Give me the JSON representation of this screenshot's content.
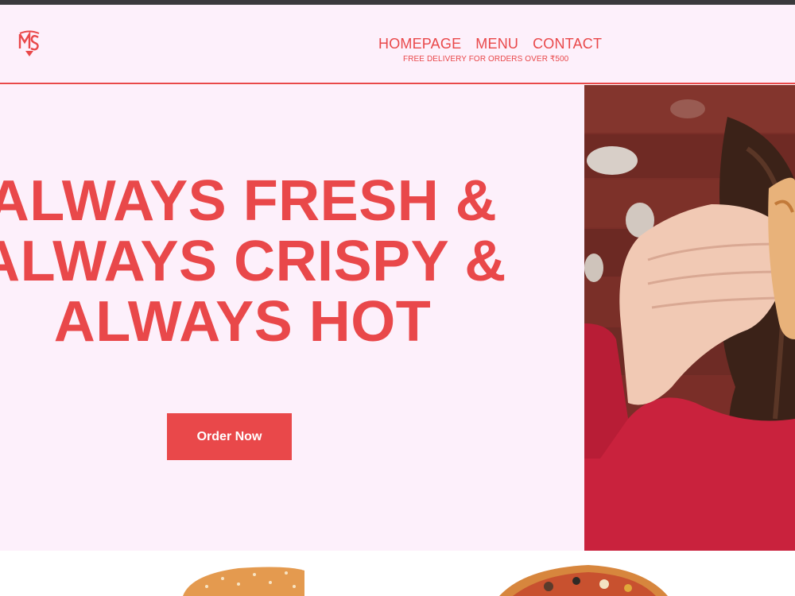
{
  "nav": {
    "links": [
      "HOMEPAGE",
      "MENU",
      "CONTACT"
    ],
    "delivery_note": "FREE DELIVERY FOR ORDERS OVER ₹500"
  },
  "hero": {
    "headline_lines": [
      "ALWAYS FRESH &",
      "ALWAYS CRISPY &",
      "ALWAYS HOT"
    ],
    "cta_label": "Order Now"
  },
  "colors": {
    "accent": "#e9484a",
    "background": "#fdf0fb",
    "topbar": "#3a3a3c"
  },
  "icons": {
    "logo": "ms-logo-icon"
  }
}
